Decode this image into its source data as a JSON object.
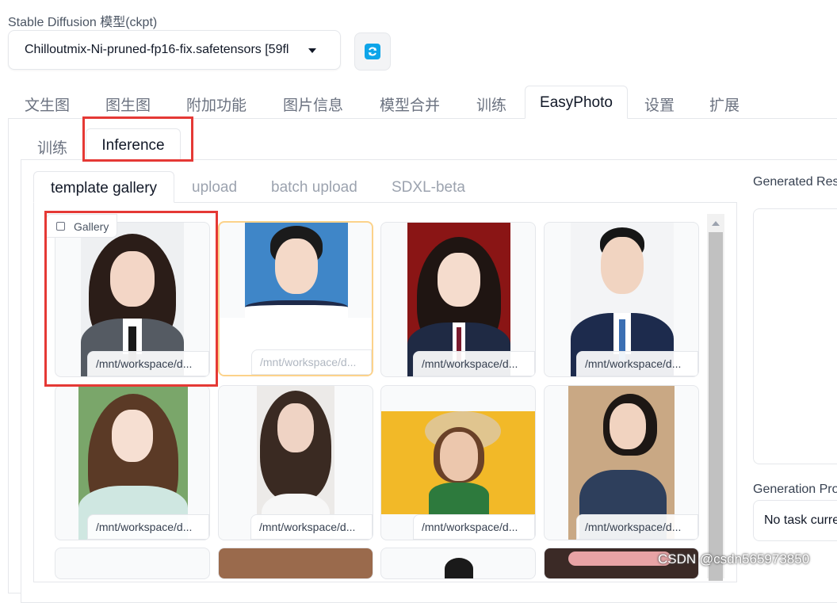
{
  "model": {
    "label": "Stable Diffusion 模型(ckpt)",
    "selected": "Chilloutmix-Ni-pruned-fp16-fix.safetensors [59fl",
    "refresh_icon": "refresh-icon"
  },
  "main_tabs": [
    "文生图",
    "图生图",
    "附加功能",
    "图片信息",
    "模型合并",
    "训练",
    "EasyPhoto",
    "设置",
    "扩展"
  ],
  "sub_tabs": [
    "训练",
    "Inference"
  ],
  "inner_tabs": [
    "template gallery",
    "upload",
    "batch upload",
    "SDXL-beta"
  ],
  "gallery": {
    "label": "Gallery",
    "icon": "image-icon",
    "items": [
      "/mnt/workspace/d...",
      "/mnt/workspace/d...",
      "/mnt/workspace/d...",
      "/mnt/workspace/d...",
      "/mnt/workspace/d...",
      "/mnt/workspace/d...",
      "/mnt/workspace/d...",
      "/mnt/workspace/d..."
    ]
  },
  "right": {
    "generated_label": "Generated Res",
    "progress_label": "Generation Pro",
    "progress_text": "No task curre"
  },
  "watermark": "CSDN @csdn565973850",
  "colors": {
    "highlight": "#e53935",
    "selected_border": "#fcd28a",
    "accent": "#0ea5e9"
  }
}
